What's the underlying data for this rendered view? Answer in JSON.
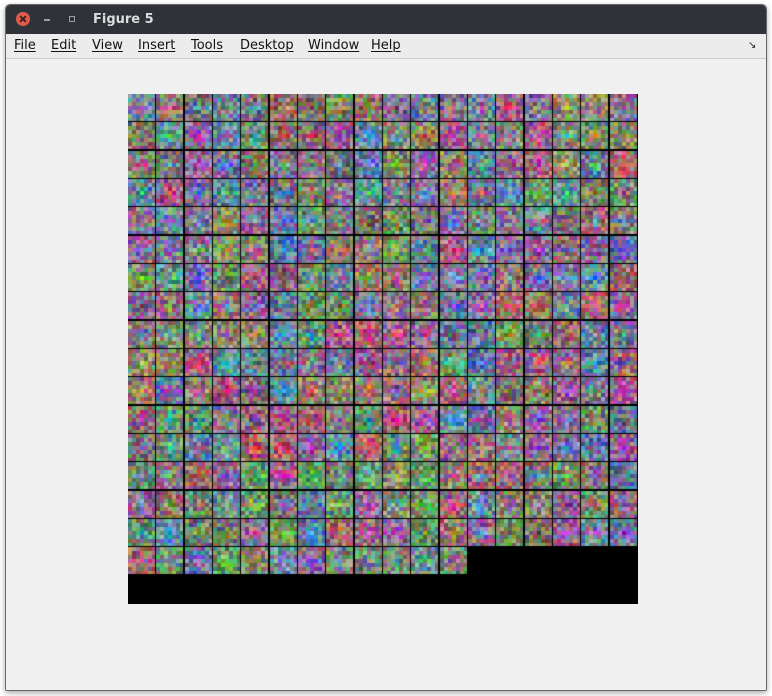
{
  "window": {
    "title": "Figure 5"
  },
  "menubar": {
    "items": [
      "File",
      "Edit",
      "View",
      "Insert",
      "Tools",
      "Desktop",
      "Window",
      "Help"
    ]
  },
  "figure": {
    "grid_cols": 18,
    "filled_tiles": 300,
    "background": "#000000",
    "content": "grid of color weight-visualization tiles"
  }
}
